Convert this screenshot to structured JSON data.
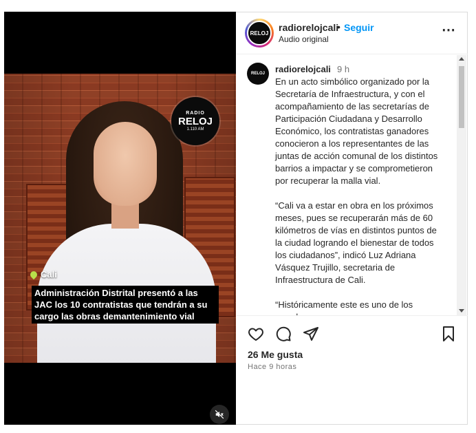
{
  "video": {
    "radio_logo": {
      "line1": "RADIO",
      "line2": "RELOJ",
      "line3": "1.110 AM"
    },
    "location": "Cali",
    "caption": "Administración Distrital presentó a las JAC los 10 contratistas que tendrán a su cargo las obras demantenimiento vial"
  },
  "header": {
    "username": "radiorelojcali",
    "separator": "•",
    "follow_label": "Seguir",
    "audio_label": "Audio original",
    "avatar_text": "RELOJ",
    "more_icon": "more-horizontal-icon"
  },
  "post": {
    "username": "radiorelojcali",
    "time": "9 h",
    "avatar_text": "RELOJ",
    "body": "En un acto simbólico organizado por la Secretaría de Infraestructura, y con el acompañamiento de las secretarías de Participación Ciudadana y Desarrollo Económico, los contratistas ganadores conocieron a los representantes de las juntas de acción comunal de los distintos barrios a impactar y se comprometieron por recuperar la malla vial.\n\n“Cali va a estar en obra en los próximos meses, pues se recuperarán más de 60 kilómetros de vías en distintos puntos de la ciudad logrando el bienestar de todos los ciudadanos”, indicó Luz Adriana Vásquez Trujillo, secretaria de Infraestructura de Cali.\n\n“Históricamente este es uno de los grandes"
  },
  "actions": {
    "likes": "26 Me gusta",
    "ago": "Hace 9 horas"
  },
  "colors": {
    "follow": "#0095f6",
    "text": "#262626",
    "muted": "#737373",
    "location_pin": "#b8e04a"
  }
}
